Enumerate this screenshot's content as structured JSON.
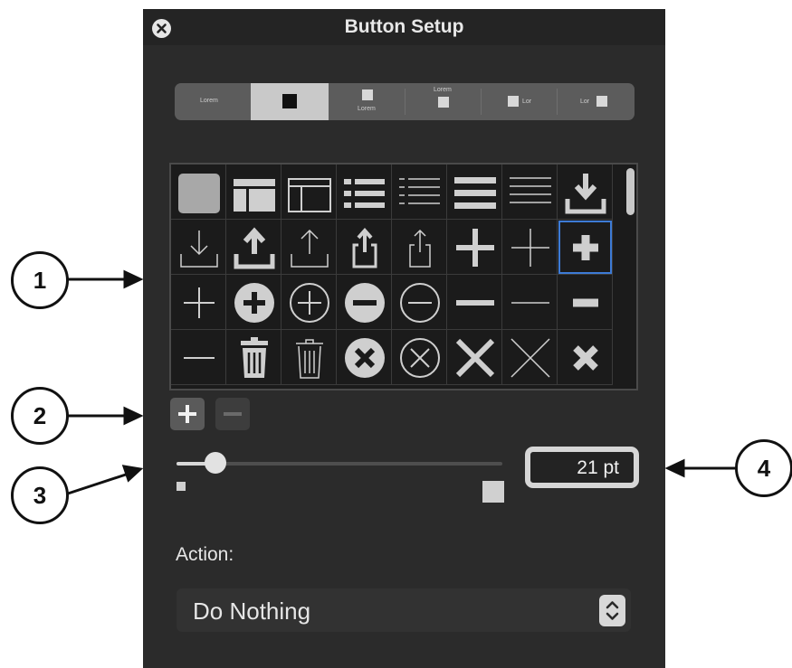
{
  "window": {
    "title": "Button Setup"
  },
  "layout_segments": [
    {
      "label": "Lorem",
      "kind": "text-only"
    },
    {
      "label": "",
      "kind": "icon-only"
    },
    {
      "label": "Lorem",
      "kind": "icon-above-text"
    },
    {
      "label": "Lorem",
      "kind": "text-above-icon"
    },
    {
      "label": "Lor",
      "kind": "icon-left-text"
    },
    {
      "label": "Lor",
      "kind": "text-left-icon"
    }
  ],
  "active_segment": 1,
  "icon_grid": {
    "rows": [
      [
        "filled-square-icon",
        "sidebar-layout-filled-icon",
        "sidebar-layout-outline-icon",
        "list-bold-icon",
        "list-dashed-icon",
        "menu-bold-icon",
        "menu-thin-icon",
        "download-tray-bold-icon"
      ],
      [
        "download-tray-thin-icon",
        "upload-tray-bold-icon",
        "upload-tray-thin-icon",
        "share-bold-icon",
        "share-thin-icon",
        "plus-bold-icon",
        "plus-thin-icon",
        "plus-heavy-icon"
      ],
      [
        "plus-light-icon",
        "plus-circle-filled-icon",
        "plus-circle-outline-icon",
        "minus-circle-filled-icon",
        "minus-circle-outline-icon",
        "minus-bold-icon",
        "minus-thin-icon",
        "minus-heavy-icon"
      ],
      [
        "minus-light-icon",
        "trash-bold-icon",
        "trash-thin-icon",
        "x-circle-filled-icon",
        "x-circle-outline-icon",
        "x-bold-icon",
        "x-thin-icon",
        "x-heavy-icon"
      ]
    ],
    "selected": "plus-heavy-icon"
  },
  "controls": {
    "add_icon": "plus-icon",
    "remove_icon": "minus-icon"
  },
  "size": {
    "slider_fraction": 0.12,
    "value_text": "21 pt"
  },
  "action": {
    "label": "Action:",
    "value": "Do Nothing"
  },
  "callouts": [
    "1",
    "2",
    "3",
    "4"
  ],
  "colors": {
    "panel": "#2b2b2b",
    "selection": "#3d7bd6"
  }
}
